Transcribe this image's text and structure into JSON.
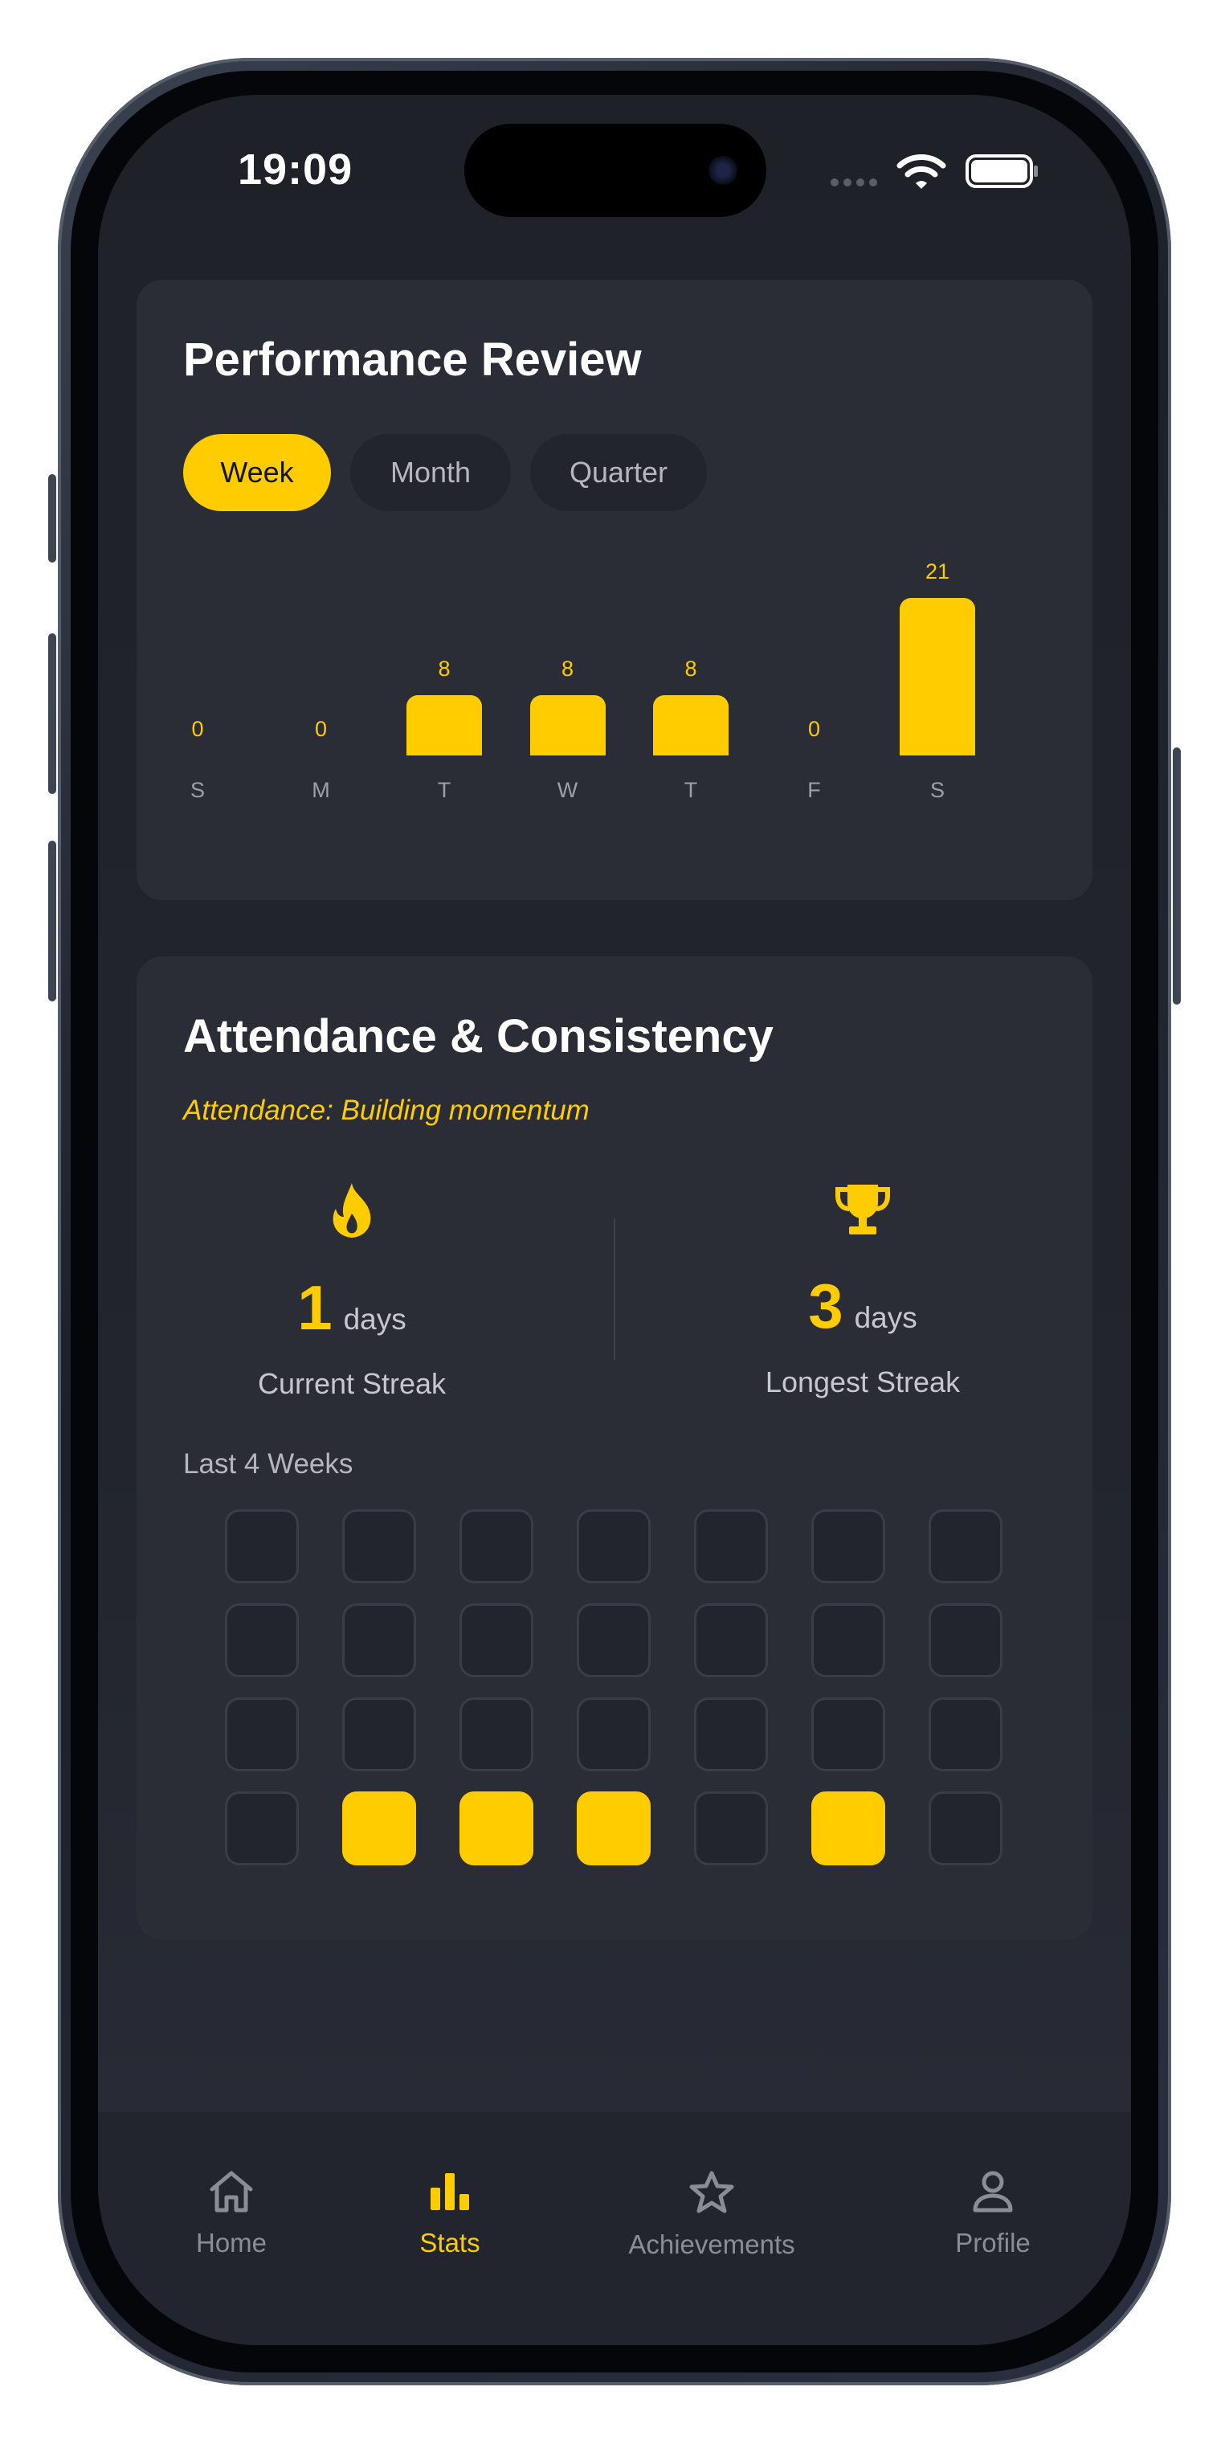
{
  "status_bar": {
    "time": "19:09"
  },
  "performance": {
    "title": "Performance Review",
    "tabs": [
      {
        "label": "Week",
        "active": true
      },
      {
        "label": "Month",
        "active": false
      },
      {
        "label": "Quarter",
        "active": false
      }
    ],
    "chart_data": {
      "type": "bar",
      "categories": [
        "S",
        "M",
        "T",
        "W",
        "T",
        "F",
        "S"
      ],
      "values": [
        0,
        0,
        8,
        8,
        8,
        0,
        21
      ],
      "data_labels": [
        "0",
        "0",
        "8",
        "8",
        "8",
        "0",
        "21"
      ],
      "ylim": [
        0,
        21
      ],
      "grid": false,
      "bar_color": "#ffcc00"
    }
  },
  "attendance": {
    "title": "Attendance & Consistency",
    "subtitle": "Attendance: Building momentum",
    "current_streak": {
      "icon": "flame-icon",
      "value": "1",
      "unit": "days",
      "label": "Current Streak"
    },
    "longest_streak": {
      "icon": "trophy-icon",
      "value": "3",
      "unit": "days",
      "label": "Longest Streak"
    },
    "weeks_label": "Last 4 Weeks",
    "grid": [
      [
        0,
        0,
        0,
        0,
        0,
        0,
        0
      ],
      [
        0,
        0,
        0,
        0,
        0,
        0,
        0
      ],
      [
        0,
        0,
        0,
        0,
        0,
        0,
        0
      ],
      [
        0,
        1,
        1,
        1,
        0,
        1,
        0
      ]
    ]
  },
  "tabbar": {
    "items": [
      {
        "label": "Home",
        "icon": "home-icon",
        "active": false
      },
      {
        "label": "Stats",
        "icon": "bar-chart-icon",
        "active": true
      },
      {
        "label": "Achievements",
        "icon": "star-icon",
        "active": false
      },
      {
        "label": "Profile",
        "icon": "person-icon",
        "active": false
      }
    ]
  },
  "colors": {
    "accent": "#ffcc00",
    "background": "#1f2129",
    "card": "#2a2c36",
    "inactive_cell": "#23252d"
  }
}
